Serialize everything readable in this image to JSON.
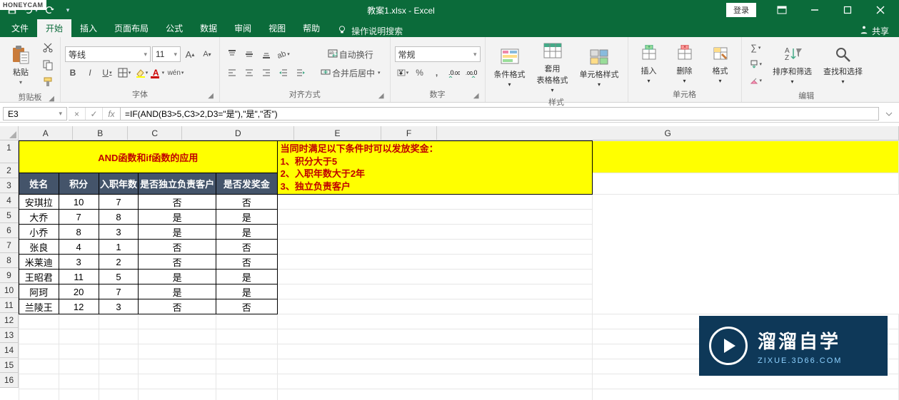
{
  "title_bar": {
    "filename": "教案1.xlsx  -  Excel",
    "login": "登录",
    "qat": {
      "save": "save",
      "undo": "undo",
      "redo": "redo"
    }
  },
  "tabs": {
    "file": "文件",
    "home": "开始",
    "insert": "插入",
    "layout": "页面布局",
    "formulas": "公式",
    "data": "数据",
    "review": "审阅",
    "view": "视图",
    "help": "帮助",
    "tellme": "操作说明搜索",
    "share": "共享"
  },
  "ribbon": {
    "clipboard": {
      "label": "剪贴板",
      "paste": "粘贴"
    },
    "font": {
      "label": "字体",
      "name": "等线",
      "size": "11"
    },
    "alignment": {
      "label": "对齐方式",
      "wrap": "自动换行",
      "merge": "合并后居中"
    },
    "number": {
      "label": "数字",
      "format": "常规"
    },
    "styles": {
      "label": "样式",
      "cond": "条件格式",
      "table": "套用\n表格格式",
      "cell": "单元格样式"
    },
    "cells": {
      "label": "单元格",
      "insert": "插入",
      "delete": "删除",
      "format": "格式"
    },
    "editing": {
      "label": "编辑",
      "sort": "排序和筛选",
      "find": "查找和选择"
    }
  },
  "name_box": "E3",
  "formula": "=IF(AND(B3>5,C3>2,D3=\"是\"),\"是\",\"否\")",
  "columns": [
    "A",
    "B",
    "C",
    "D",
    "E",
    "F",
    "G"
  ],
  "rows": [
    "1",
    "2",
    "3",
    "4",
    "5",
    "6",
    "7",
    "8",
    "9",
    "10",
    "11",
    "12",
    "13",
    "14",
    "15",
    "16"
  ],
  "sheet": {
    "merged_title": "AND函数和if函数的应用",
    "headers": [
      "姓名",
      "积分",
      "入职年数",
      "是否独立负责客户",
      "是否发奖金"
    ],
    "data": [
      [
        "安琪拉",
        "10",
        "7",
        "否",
        "否"
      ],
      [
        "大乔",
        "7",
        "8",
        "是",
        "是"
      ],
      [
        "小乔",
        "8",
        "3",
        "是",
        "是"
      ],
      [
        "张良",
        "4",
        "1",
        "否",
        "否"
      ],
      [
        "米莱迪",
        "3",
        "2",
        "否",
        "否"
      ],
      [
        "王昭君",
        "11",
        "5",
        "是",
        "是"
      ],
      [
        "阿珂",
        "20",
        "7",
        "是",
        "是"
      ],
      [
        "兰陵王",
        "12",
        "3",
        "否",
        "否"
      ]
    ],
    "f_note": "当同时满足以下条件时可以发放奖金：\n1、积分大于5\n2、入职年数大于2年\n3、独立负责客户"
  },
  "watermark": "HONEYCAM",
  "logo": {
    "cn": "溜溜自学",
    "en": "ZIXUE.3D66.COM"
  }
}
